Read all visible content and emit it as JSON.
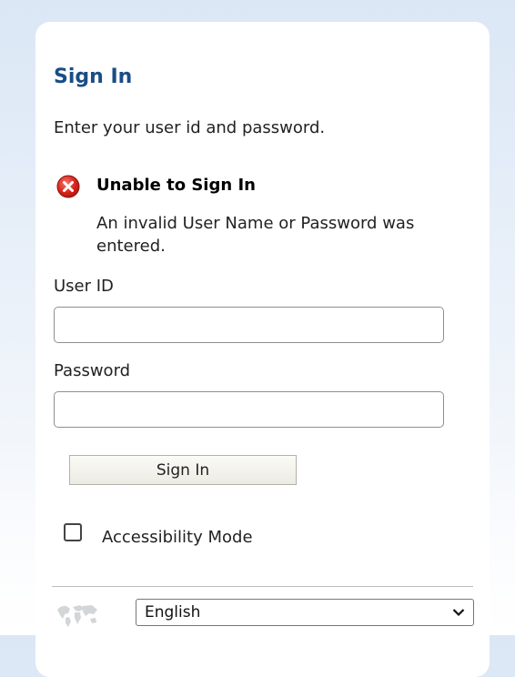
{
  "signin": {
    "title": "Sign In",
    "subtitle": "Enter your user id and password."
  },
  "error": {
    "icon": "error-x-icon",
    "title": "Unable to Sign In",
    "message": "An invalid User Name or Password was entered."
  },
  "form": {
    "userid_label": "User ID",
    "userid_value": "",
    "password_label": "Password",
    "password_value": "",
    "submit_label": "Sign In",
    "accessibility_label": "Accessibility Mode",
    "accessibility_checked": false
  },
  "language": {
    "icon": "globe-map-icon",
    "selected": "English"
  },
  "colors": {
    "title": "#1a4d85",
    "error_icon": "#d9251c",
    "background": "#dbe7f5"
  }
}
